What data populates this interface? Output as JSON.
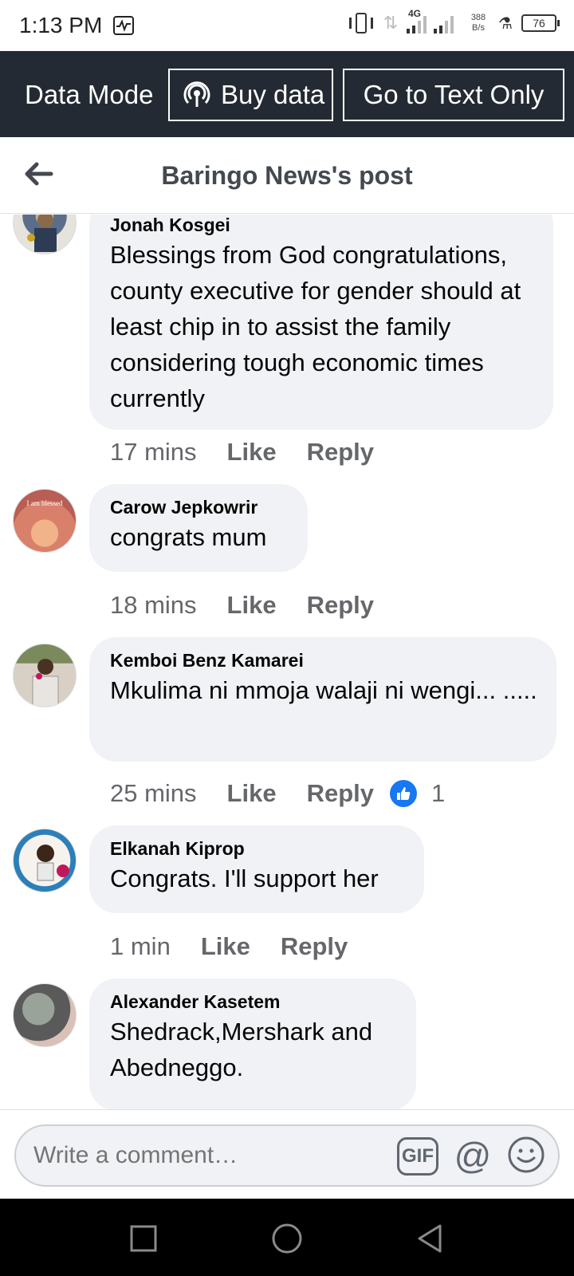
{
  "status": {
    "time": "1:13 PM",
    "network": "4G",
    "rate_value": "388",
    "rate_unit": "B/s",
    "battery": "76"
  },
  "data_bar": {
    "mode_label": "Data Mode",
    "buy_label": "Buy data",
    "text_only_label": "Go to Text Only"
  },
  "header": {
    "title": "Baringo News's post"
  },
  "comments": [
    {
      "author": "Jonah Kosgei",
      "text": "Blessings from God congratulations, county executive for gender should at least chip in to assist the family considering tough economic times currently",
      "time": "17 mins",
      "like": "Like",
      "reply": "Reply"
    },
    {
      "author": "Carow Jepkowrir",
      "text": "congrats mum",
      "time": "18 mins",
      "like": "Like",
      "reply": "Reply",
      "avatar_text": "I am blessed"
    },
    {
      "author": "Kemboi Benz Kamarei",
      "text": "Mkulima ni mmoja walaji ni wengi... .....",
      "time": "25 mins",
      "like": "Like",
      "reply": "Reply",
      "reactions": "1"
    },
    {
      "author": "Elkanah Kiprop",
      "text": "Congrats. I'll support her",
      "time": "1 min",
      "like": "Like",
      "reply": "Reply"
    },
    {
      "author": "Alexander Kasetem",
      "text": "Shedrack,Mershark and Abedneggo."
    }
  ],
  "composer": {
    "placeholder": "Write a comment…",
    "gif_label": "GIF",
    "at_label": "@"
  },
  "colors": {
    "data_bar_bg": "#242a33",
    "bubble_bg": "#f0f2f5",
    "meta_text": "#65676b",
    "like_blue": "#1877f2"
  }
}
